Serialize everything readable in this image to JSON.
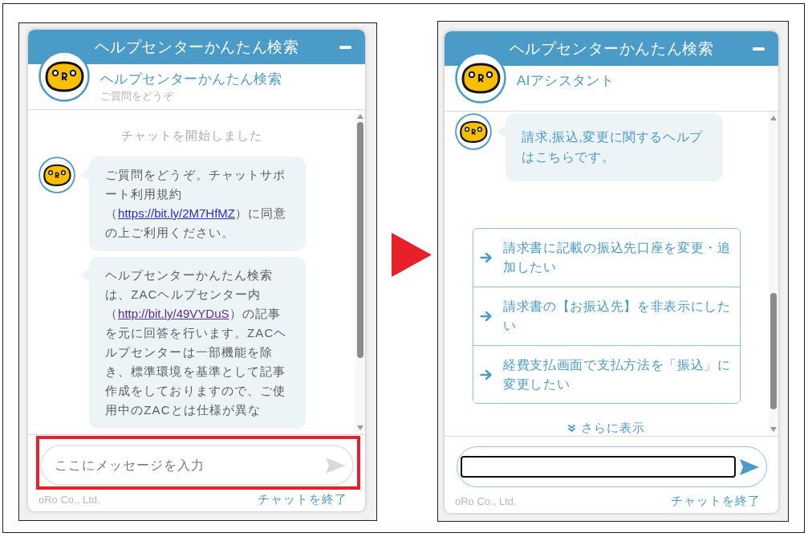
{
  "panels": [
    {
      "header": {
        "title": "ヘルプセンターかんたん検索"
      },
      "profile": {
        "name": "ヘルプセンターかんたん検索",
        "subtitle": "ご質問をどうぞ"
      },
      "chat": [
        {
          "kind": "system",
          "text": "チャットを開始しました"
        },
        {
          "kind": "message",
          "avatar": true,
          "parts": [
            {
              "kind": "text",
              "text": "ご質問をどうぞ。チャットサポート利用規約（"
            },
            {
              "kind": "link",
              "text": "https://bit.ly/2M7HfMZ",
              "visited": false
            },
            {
              "kind": "text",
              "text": "）に同意の上ご利用ください。"
            }
          ]
        },
        {
          "kind": "message",
          "avatar": false,
          "parts": [
            {
              "kind": "text",
              "text": "ヘルプセンターかんたん検索は、ZACヘルプセンター内（"
            },
            {
              "kind": "link",
              "text": "http://bit.ly/49VYDuS",
              "visited": true
            },
            {
              "kind": "text",
              "text": "）の記事を元に回答を行います。ZACヘルプセンターは一部機能を除き、標準環境を基準として記事作成をしておりますので、ご使用中のZACとは仕様が異な"
            }
          ]
        }
      ],
      "input": {
        "placeholder": "ここにメッセージを入力",
        "focused": false,
        "highlighted": true
      },
      "send_button": {
        "disabled": true
      },
      "footer": {
        "company": "oRo Co., Ltd.",
        "end_chat": "チャットを終了"
      }
    },
    {
      "header": {
        "title": "ヘルプセンターかんたん検索"
      },
      "profile": {
        "name": "AIアシスタント"
      },
      "chat": [
        {
          "kind": "answer",
          "avatar": true,
          "parts": [
            {
              "kind": "text",
              "text": "請求,振込,変更に関するヘルプはこちらです。"
            }
          ]
        },
        {
          "kind": "options",
          "items": [
            "請求書に記載の振込先口座を変更・追加したい",
            "請求書の【お振込先】を非表示にしたい",
            "経費支払画面で支払方法を「振込」に変更したい"
          ]
        },
        {
          "kind": "more",
          "text": "さらに表示"
        }
      ],
      "input": {
        "focused": true,
        "highlighted": false
      },
      "send_button": {
        "disabled": false
      },
      "footer": {
        "company": "oRo Co., Ltd.",
        "end_chat": "チャットを終了"
      }
    }
  ]
}
